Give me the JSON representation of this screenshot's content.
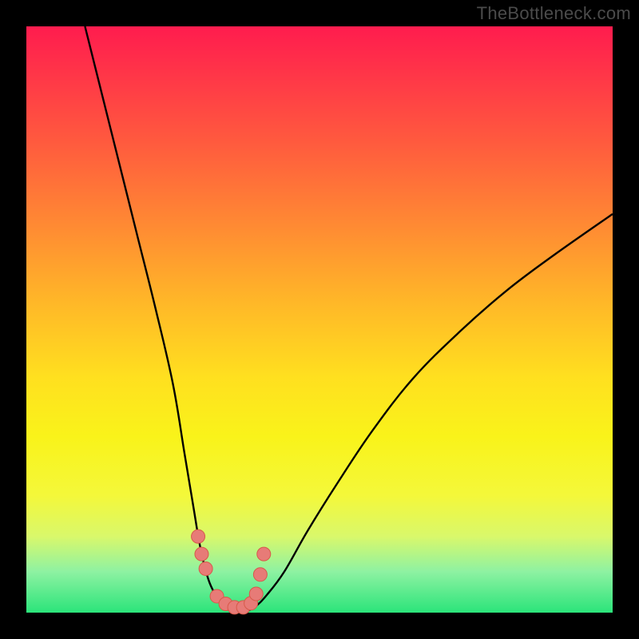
{
  "attribution": "TheBottleneck.com",
  "colors": {
    "frame": "#000000",
    "curve": "#000000",
    "marker_fill": "#e77b77",
    "marker_stroke": "#d75a4a"
  },
  "chart_data": {
    "type": "line",
    "title": "",
    "xlabel": "",
    "ylabel": "",
    "xlim": [
      0,
      100
    ],
    "ylim": [
      0,
      100
    ],
    "series": [
      {
        "name": "left-branch",
        "x": [
          10,
          13,
          16,
          19,
          22,
          25,
          27,
          28.5,
          29.5,
          30.5,
          31.5,
          33,
          35,
          37
        ],
        "y": [
          100,
          88,
          76,
          64,
          52,
          39,
          27,
          18,
          12,
          7.5,
          4.5,
          2,
          0.5,
          0
        ]
      },
      {
        "name": "right-branch",
        "x": [
          37,
          39,
          41,
          44,
          48,
          53,
          59,
          66,
          74,
          82,
          90,
          100
        ],
        "y": [
          0,
          1,
          3,
          7,
          14,
          22,
          31,
          40,
          48,
          55,
          61,
          68
        ]
      }
    ],
    "markers": {
      "name": "highlight-dots",
      "x": [
        29.3,
        29.9,
        30.6,
        32.5,
        34,
        35.5,
        37,
        38.3,
        39.2,
        39.9,
        40.5
      ],
      "y": [
        13,
        10,
        7.5,
        2.8,
        1.5,
        0.9,
        0.9,
        1.6,
        3.2,
        6.5,
        10
      ]
    }
  }
}
